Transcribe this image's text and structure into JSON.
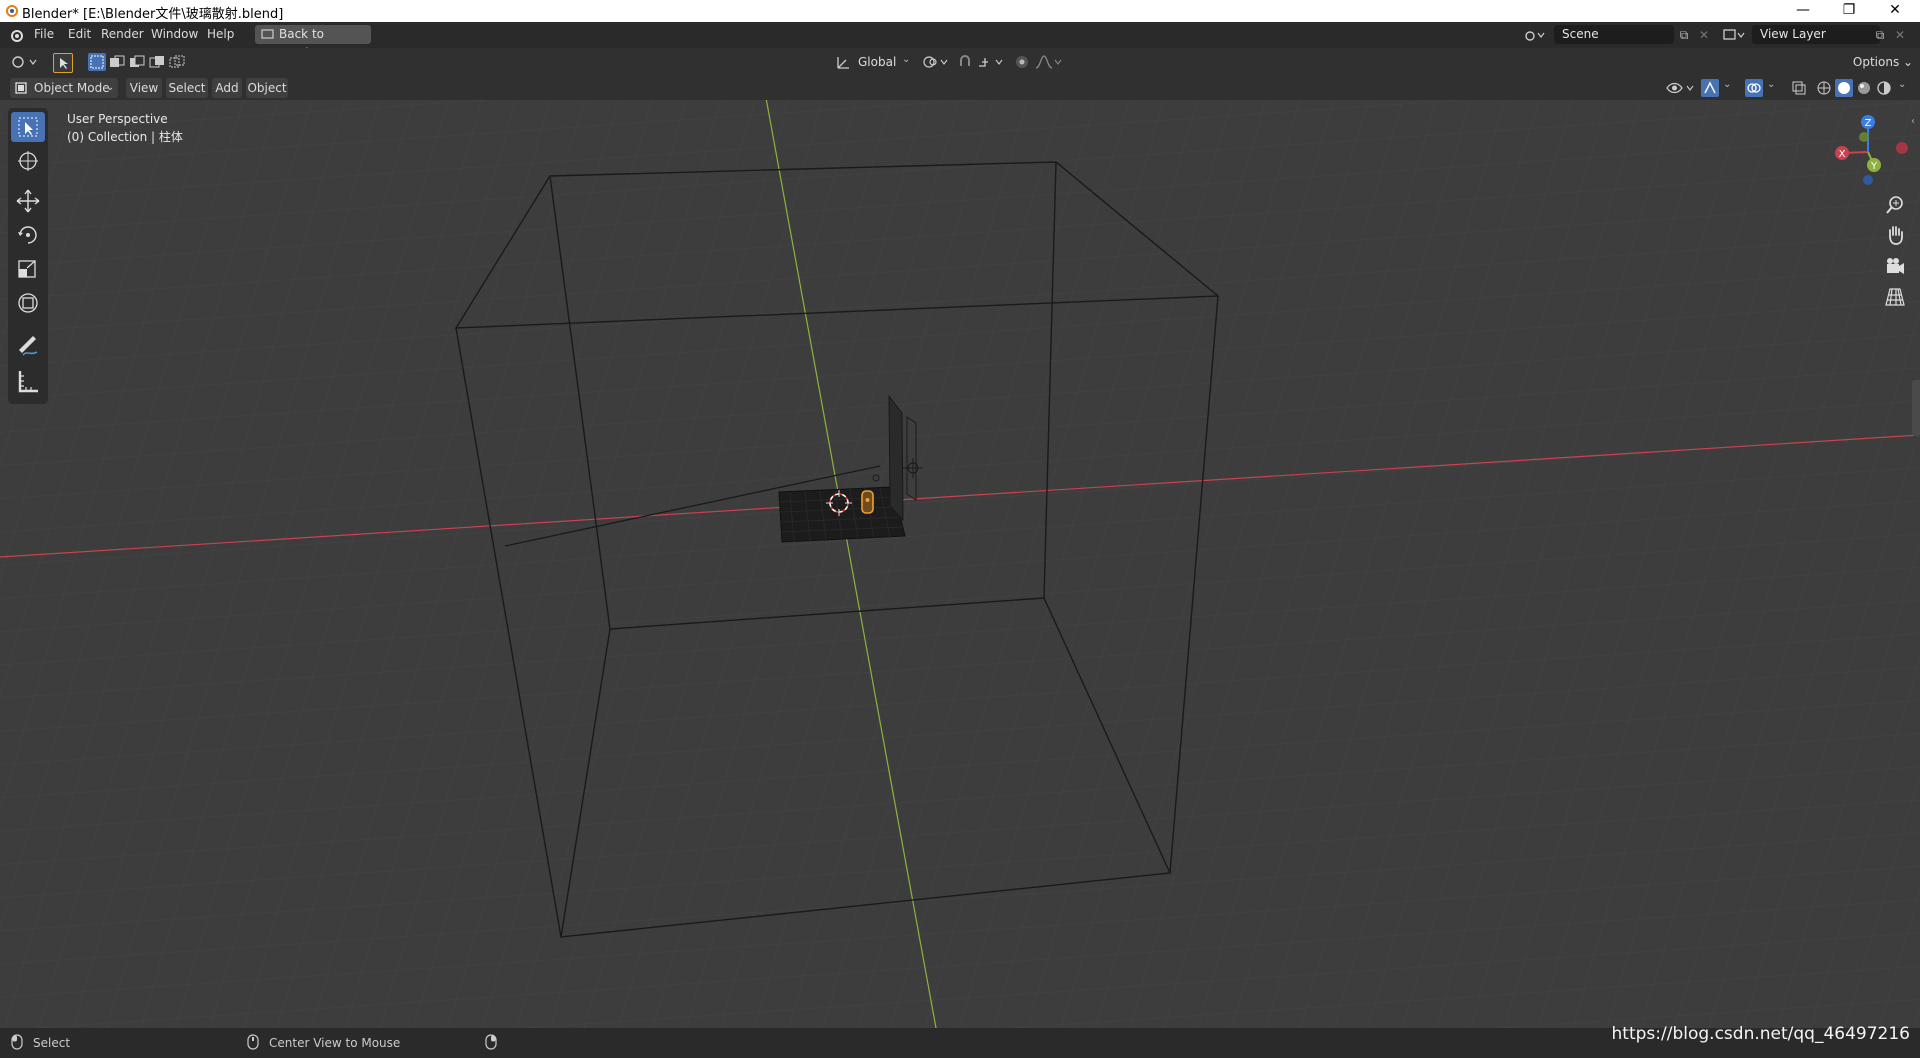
{
  "window": {
    "title": "Blender* [E:\\Blender文件\\玻璃散射.blend]",
    "minimize": "—",
    "restore": "❐",
    "close": "✕"
  },
  "menubar": {
    "items": [
      "File",
      "Edit",
      "Render",
      "Window",
      "Help"
    ],
    "back_button": "Back to Previous",
    "scene_value": "Scene",
    "view_layer_value": "View Layer"
  },
  "toolhdr": {
    "transform_orientation": "Global",
    "options_label": "Options"
  },
  "viewhdr": {
    "mode": "Object Mode",
    "menus": [
      "View",
      "Select",
      "Add",
      "Object"
    ]
  },
  "viewport": {
    "perspective_label": "User Perspective",
    "collection_label": "(0) Collection | 柱体",
    "axis_labels": {
      "x": "X",
      "y": "Y",
      "z": "Z"
    }
  },
  "statusbar": {
    "left_hint": "Select",
    "middle_hint": "Center View to Mouse"
  },
  "watermark": "https://blog.csdn.net/qq_46497216",
  "colors": {
    "x_axis": "#c8424f",
    "y_axis": "#8db33e",
    "z_axis": "#3b7de0",
    "accent": "#4772b3",
    "selected": "#f0a030"
  }
}
